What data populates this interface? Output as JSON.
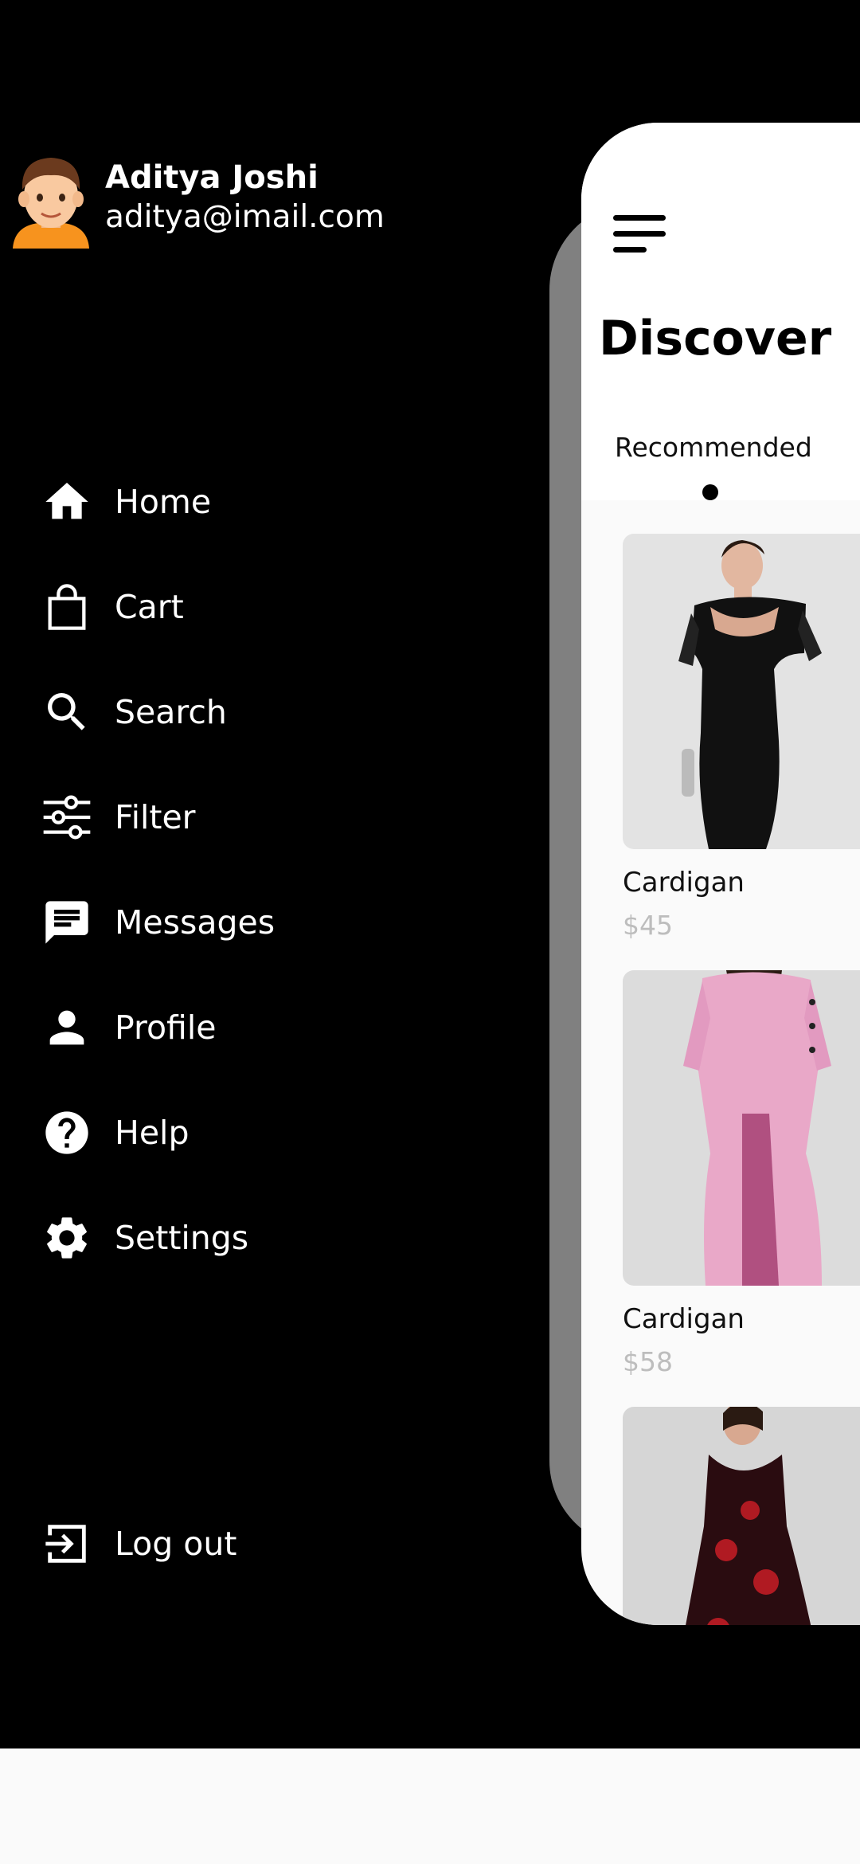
{
  "drawer": {
    "user": {
      "name": "Aditya Joshi",
      "email": "aditya@imail.com"
    },
    "items": [
      {
        "label": "Home",
        "icon": "home-icon"
      },
      {
        "label": "Cart",
        "icon": "shopping-bag-icon"
      },
      {
        "label": "Search",
        "icon": "search-icon"
      },
      {
        "label": "Filter",
        "icon": "filter-sliders-icon"
      },
      {
        "label": "Messages",
        "icon": "message-icon"
      },
      {
        "label": "Profile",
        "icon": "person-icon"
      },
      {
        "label": "Help",
        "icon": "help-icon"
      },
      {
        "label": "Settings",
        "icon": "gear-icon"
      }
    ],
    "logout": {
      "label": "Log out",
      "icon": "logout-icon"
    }
  },
  "app": {
    "title": "Discover",
    "tabs": [
      {
        "label": "Recommended",
        "active": true
      }
    ],
    "products": [
      {
        "name": "Cardigan",
        "price": "$45"
      },
      {
        "name": "Cardigan",
        "price": "$58"
      },
      {
        "name": "",
        "price": ""
      }
    ]
  },
  "colors": {
    "drawer_bg": "#000000",
    "card_bg": "#ffffff",
    "back_card": "#808080",
    "price_text": "#bdbdbd"
  }
}
